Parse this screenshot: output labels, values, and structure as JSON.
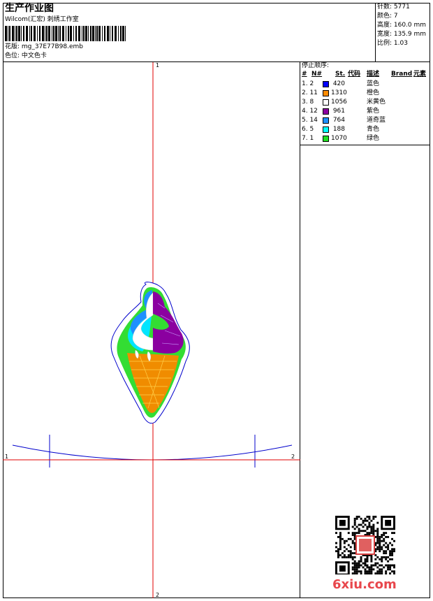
{
  "header": {
    "title": "生产作业图",
    "subtitle": "Wilcom(汇宏) 刺绣工作室",
    "design_line": "花版: mg_37E77B98.emb",
    "colorway_line": "色位: 中文色卡"
  },
  "stats": {
    "stitches": "针数: 5771",
    "colors": "颜色: 7",
    "height": "高度: 160.0 mm",
    "width": "宽度: 135.9 mm",
    "scale": "比例: 1.03"
  },
  "color_table": {
    "title": "停止顺序:",
    "headers": {
      "idx": "#",
      "n": "N#",
      "st": "St.",
      "code": "代码",
      "desc": "描述",
      "brand": "Brand",
      "elements": "元素"
    },
    "rows": [
      {
        "idx": "1. 2",
        "swatch": "#0000ff",
        "code": "420",
        "desc": "蓝色"
      },
      {
        "idx": "2. 11",
        "swatch": "#ff8c00",
        "code": "1310",
        "desc": "橙色"
      },
      {
        "idx": "3. 8",
        "swatch": "#ffffff",
        "code": "1056",
        "desc": "米黄色"
      },
      {
        "idx": "4. 12",
        "swatch": "#8b00a0",
        "code": "961",
        "desc": "紫色"
      },
      {
        "idx": "5. 14",
        "swatch": "#1e90ff",
        "code": "764",
        "desc": "道奇蓝"
      },
      {
        "idx": "6. 5",
        "swatch": "#00ffff",
        "code": "188",
        "desc": "青色"
      },
      {
        "idx": "7. 1",
        "swatch": "#22e022",
        "code": "1070",
        "desc": "绿色"
      }
    ]
  },
  "canvas": {
    "axis_labels": {
      "top": "1",
      "left": "1",
      "right": "2",
      "bottom": "2"
    },
    "colors": {
      "axis": "#e00000",
      "outline": "#0000cc",
      "cone": "#f08c00",
      "green": "#33dd33"
    }
  },
  "watermark": {
    "logo_text": "6xiu.com"
  }
}
